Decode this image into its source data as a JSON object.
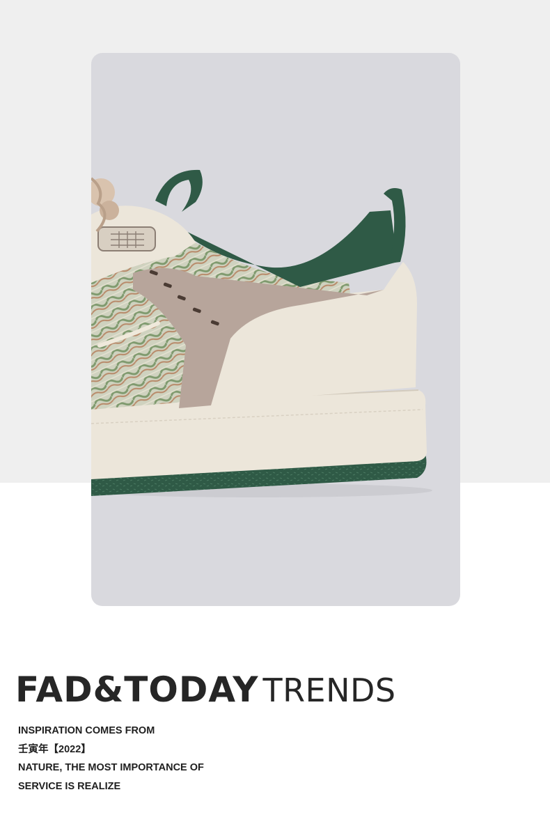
{
  "headline": {
    "bold": "FAD&TODAY",
    "light": "TRENDS"
  },
  "body_lines": [
    "INSPIRATION COMES FROM",
    "壬寅年【2022】",
    "NATURE, THE MOST IMPORTANCE OF",
    "SERVICE IS REALIZE"
  ],
  "colors": {
    "top_band": "#efefef",
    "card": "#d9d9de",
    "outsole_green": "#2f5a46",
    "sole_cream": "#ece6da",
    "taupe": "#b7a59b"
  }
}
